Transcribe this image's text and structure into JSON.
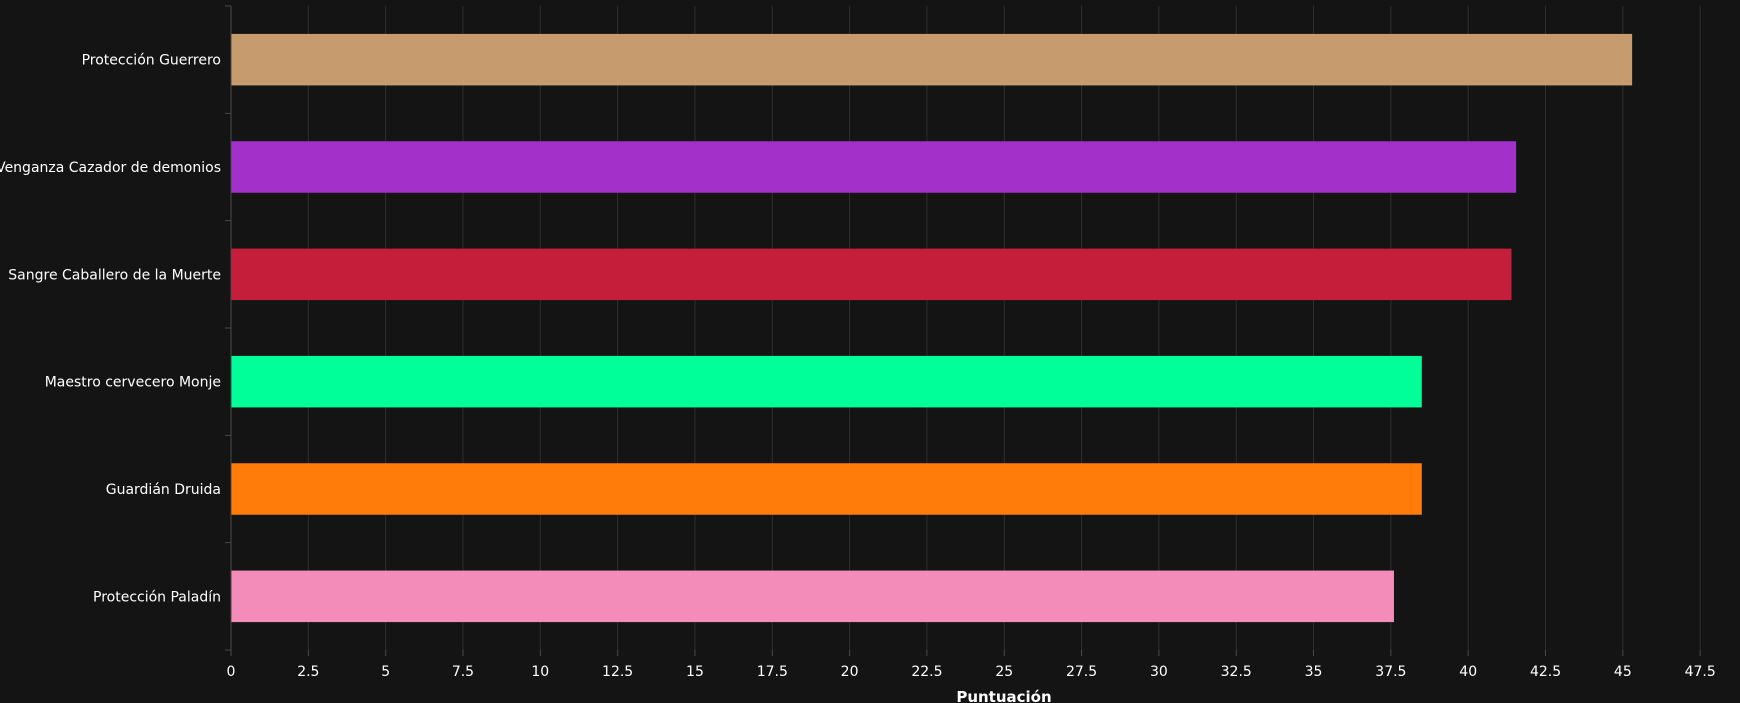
{
  "chart_data": {
    "type": "bar",
    "orientation": "horizontal",
    "categories": [
      "Protección Guerrero",
      "Venganza Cazador de demonios",
      "Sangre Caballero de la Muerte",
      "Maestro cervecero Monje",
      "Guardián Druida",
      "Protección Paladín"
    ],
    "values": [
      45.3,
      41.55,
      41.4,
      38.5,
      38.5,
      37.6
    ],
    "colors": [
      "#C69B6D",
      "#A330C9",
      "#C41E3A",
      "#00FF98",
      "#FF7C0A",
      "#F48CBA"
    ],
    "xlabel": "Puntuación",
    "ylabel": "",
    "xlim": [
      0,
      48.5
    ],
    "xticks": [
      "0",
      "2.5",
      "5",
      "7.5",
      "10",
      "12.5",
      "15",
      "17.5",
      "20",
      "22.5",
      "25",
      "27.5",
      "30",
      "32.5",
      "35",
      "37.5",
      "40",
      "42.5",
      "45",
      "47.5"
    ],
    "grid": true,
    "background": "#141414"
  }
}
